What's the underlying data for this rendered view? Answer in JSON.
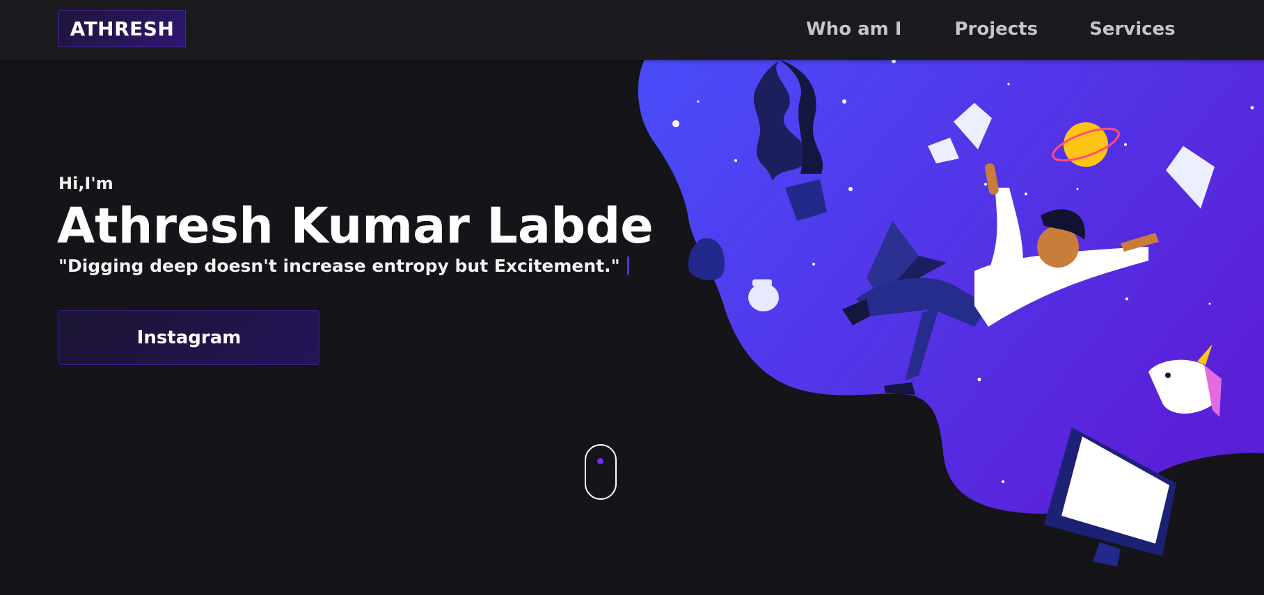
{
  "header": {
    "logo": "ATHRESH",
    "nav": [
      "Who am I",
      "Projects",
      "Services"
    ]
  },
  "hero": {
    "greeting": "Hi,I'm",
    "name": "Athresh Kumar Labde",
    "tagline": "\"Digging deep doesn't increase entropy but Excitement.\"",
    "cta_label": "Instagram"
  },
  "colors": {
    "background": "#141419",
    "navbar": "#1a1a1f",
    "accent": "#4b24b0",
    "blob_start": "#4a4dfa",
    "blob_end": "#5a20d8",
    "scroll_dot": "#6d2ff0"
  },
  "icons": {
    "scroll_indicator": "mouse-scroll-icon",
    "illustration": "falling-man-space-illustration"
  }
}
